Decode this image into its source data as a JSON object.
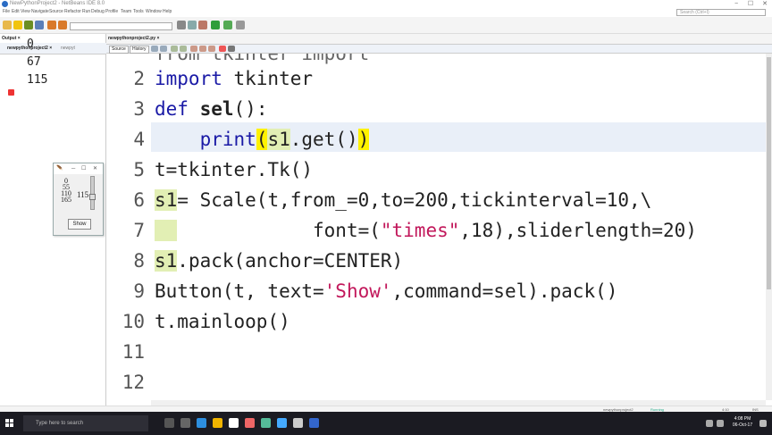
{
  "window": {
    "title": "NewPythonProject2 - NetBeans IDE 8.0",
    "min": "−",
    "max": "☐",
    "close": "✕"
  },
  "menu": [
    "File",
    "Edit",
    "View",
    "Navigate",
    "Source",
    "Refactor",
    "Run",
    "Debug",
    "Profile",
    "Team",
    "Tools",
    "Window",
    "Help"
  ],
  "search": {
    "placeholder": "Search (Ctrl+I)"
  },
  "output": {
    "tab": "Output ×",
    "subtab": "newpythonproject2 ×",
    "subtab2": "newpyt",
    "lines": [
      "0",
      "67",
      "115"
    ]
  },
  "tk_window": {
    "icon": "🪶",
    "min": "─",
    "max": "☐",
    "close": "✕",
    "scale_labels": [
      "0",
      "55",
      "110",
      "165"
    ],
    "value": "115",
    "button": "Show"
  },
  "editor": {
    "tab": "newpythonproject2.py ×",
    "source_label": "Source",
    "history_label": "History",
    "partial_top_line": "from tkinter import",
    "line_numbers": [
      "2",
      "3",
      "4",
      "5",
      "6",
      "7",
      "8",
      "9",
      "10",
      "11",
      "12"
    ]
  },
  "status": {
    "project": "newpythonproject2",
    "running": "Running",
    "position": "4:10",
    "mode": "INS"
  },
  "taskbar": {
    "search_placeholder": "Type here to search",
    "time": "4:08 PM",
    "date": "06-Oct-17"
  },
  "colors": {
    "keyword": "#1a1aa6",
    "string": "#c2185b",
    "bracket_highlight": "#fff200",
    "current_line": "#e9eff8",
    "taskbar": "#1b1b22"
  }
}
